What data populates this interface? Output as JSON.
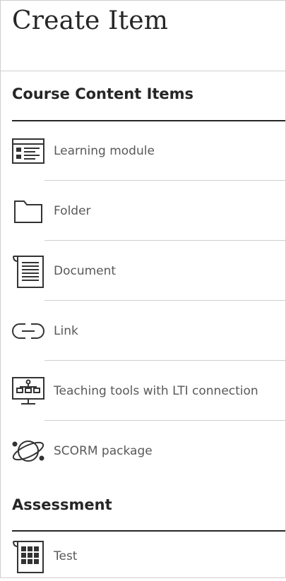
{
  "panel": {
    "title": "Create Item"
  },
  "sections": {
    "course": {
      "heading": "Course Content Items",
      "items": [
        {
          "label": "Learning module",
          "icon": "learning-module-icon"
        },
        {
          "label": "Folder",
          "icon": "folder-icon"
        },
        {
          "label": "Document",
          "icon": "document-icon"
        },
        {
          "label": "Link",
          "icon": "link-icon"
        },
        {
          "label": "Teaching tools with LTI connection",
          "icon": "lti-tools-icon"
        },
        {
          "label": "SCORM package",
          "icon": "scorm-package-icon"
        }
      ]
    },
    "assessment": {
      "heading": "Assessment",
      "items": [
        {
          "label": "Test",
          "icon": "test-icon"
        }
      ]
    }
  },
  "colors": {
    "text": "#262626",
    "muted": "#595959",
    "divider": "#cfcfcf",
    "icon": "#333333"
  }
}
